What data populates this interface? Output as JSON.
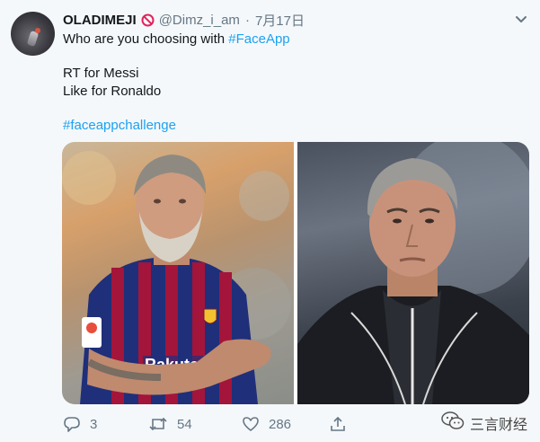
{
  "tweet": {
    "author_name": "OLADIMEJI",
    "author_handle": "@Dimz_i_am",
    "separator": "·",
    "date": "7月17日",
    "line1_prefix": "Who are you choosing with ",
    "line1_hashtag": "#FaceApp",
    "line2": "RT for Messi",
    "line3": "Like for Ronaldo",
    "hashtag2": "#faceappchallenge"
  },
  "media": [
    {
      "name": "messi-faceapp-photo",
      "jersey_text": "Rakuten"
    },
    {
      "name": "ronaldo-faceapp-photo"
    }
  ],
  "actions": {
    "replies": "3",
    "retweets": "54",
    "likes": "286"
  },
  "watermark": {
    "text": "三言财经"
  },
  "icons": [
    "no-entry-icon",
    "caret-down-icon",
    "reply-icon",
    "retweet-icon",
    "heart-icon",
    "share-icon",
    "wechat-icon"
  ],
  "colors": {
    "accent": "#1da1f2",
    "muted": "#657786",
    "background": "#f5f8fa"
  }
}
